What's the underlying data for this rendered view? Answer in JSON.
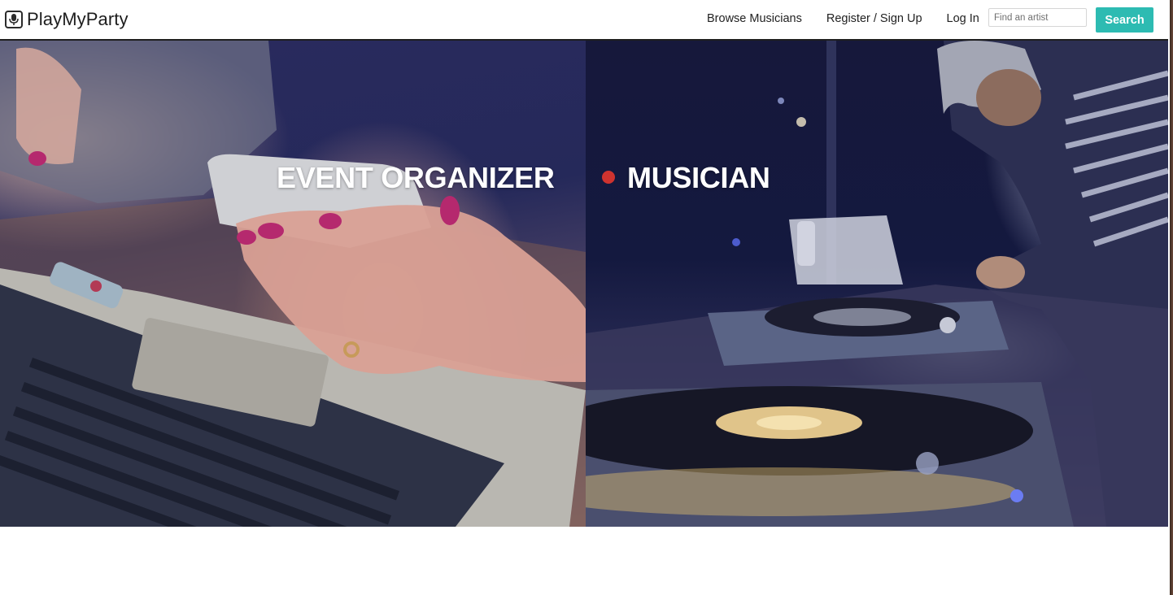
{
  "brand": {
    "name": "PlayMyParty",
    "icon": "microphone-icon"
  },
  "nav": {
    "browse": "Browse Musicians",
    "register": "Register / Sign Up",
    "login": "Log In"
  },
  "search": {
    "placeholder": "Find an artist",
    "value": "",
    "button_label": "Search"
  },
  "hero": {
    "organizer_title": "EVENT ORGANIZER",
    "musician_title": "MUSICIAN"
  },
  "colors": {
    "accent": "#2dbbb2",
    "navbar_border": "#1e1e1e",
    "hero_text": "#ffffff"
  }
}
